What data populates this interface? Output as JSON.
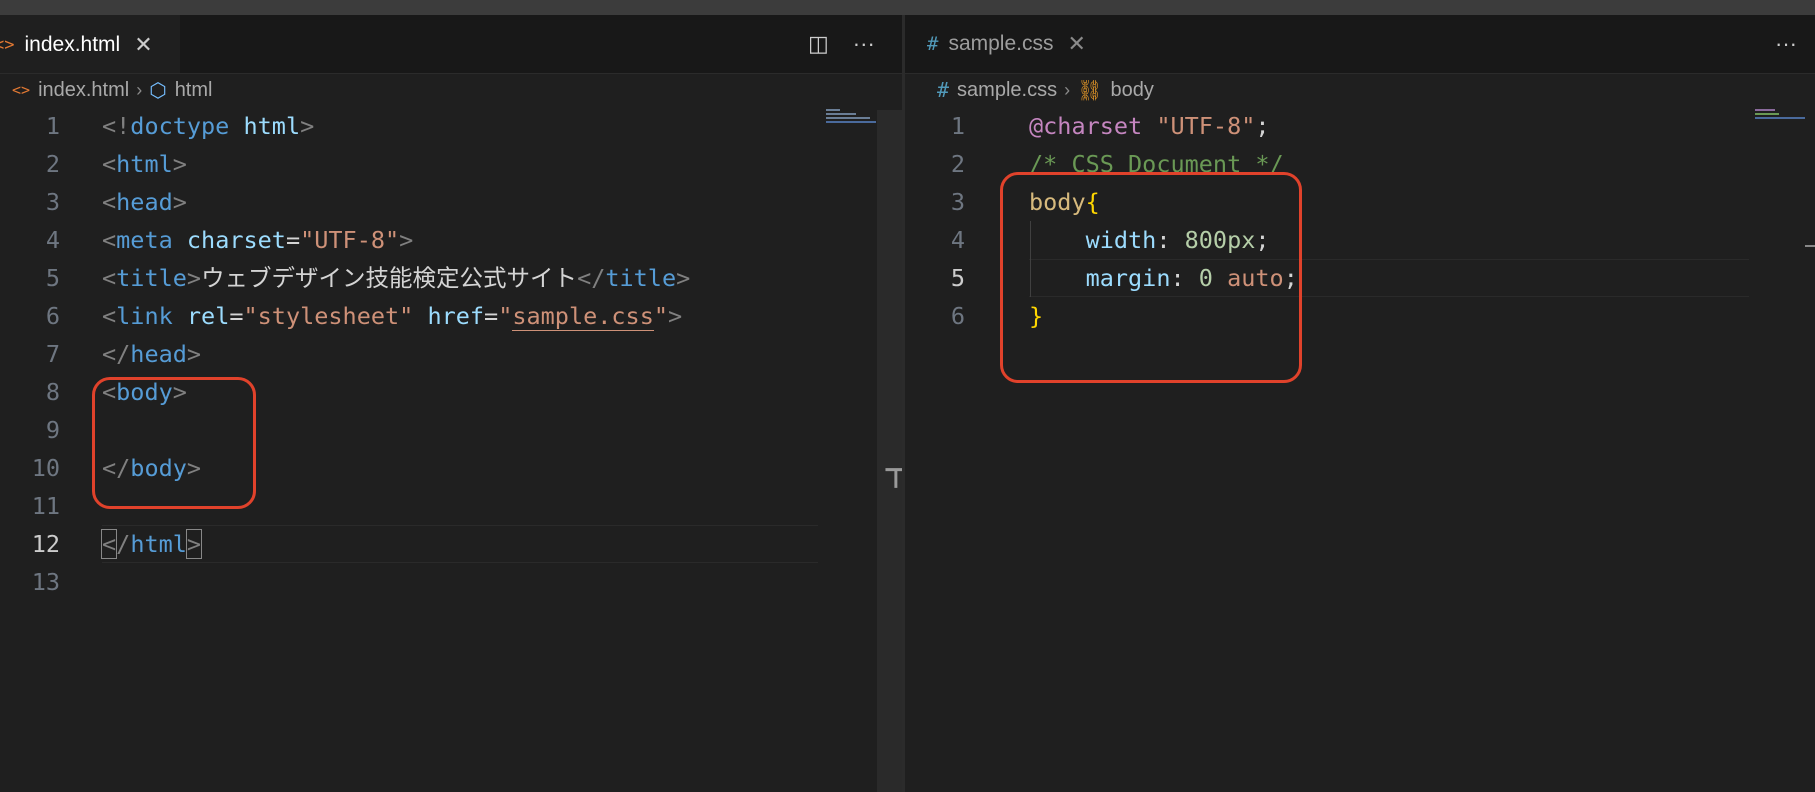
{
  "left_editor": {
    "tab": {
      "icon": "html-file-icon",
      "label": "index.html"
    },
    "breadcrumb": [
      {
        "icon": "html-file-icon",
        "label": "index.html"
      },
      {
        "icon": "symbol-element-icon",
        "label": "html"
      }
    ],
    "current_line": 12,
    "lines": [
      {
        "n": "1",
        "tokens": [
          [
            "bracket",
            "<!"
          ],
          [
            "tag",
            "doctype"
          ],
          [
            "text",
            " "
          ],
          [
            "attr",
            "html"
          ],
          [
            "bracket",
            ">"
          ]
        ]
      },
      {
        "n": "2",
        "tokens": [
          [
            "bracket",
            "<"
          ],
          [
            "tag",
            "html"
          ],
          [
            "bracket",
            ">"
          ]
        ]
      },
      {
        "n": "3",
        "tokens": [
          [
            "bracket",
            "<"
          ],
          [
            "tag",
            "head"
          ],
          [
            "bracket",
            ">"
          ]
        ]
      },
      {
        "n": "4",
        "tokens": [
          [
            "bracket",
            "<"
          ],
          [
            "tag",
            "meta"
          ],
          [
            "text",
            " "
          ],
          [
            "attr",
            "charset"
          ],
          [
            "eq",
            "="
          ],
          [
            "str",
            "\"UTF-8\""
          ],
          [
            "bracket",
            ">"
          ]
        ]
      },
      {
        "n": "5",
        "tokens": [
          [
            "bracket",
            "<"
          ],
          [
            "tag",
            "title"
          ],
          [
            "bracket",
            ">"
          ],
          [
            "text",
            "ウェブデザイン技能検定公式サイト"
          ],
          [
            "bracket",
            "</"
          ],
          [
            "tag",
            "title"
          ],
          [
            "bracket",
            ">"
          ]
        ]
      },
      {
        "n": "6",
        "tokens": [
          [
            "bracket",
            "<"
          ],
          [
            "tag",
            "link"
          ],
          [
            "text",
            " "
          ],
          [
            "attr",
            "rel"
          ],
          [
            "eq",
            "="
          ],
          [
            "str",
            "\"stylesheet\""
          ],
          [
            "text",
            " "
          ],
          [
            "attr",
            "href"
          ],
          [
            "eq",
            "="
          ],
          [
            "str",
            "\""
          ],
          [
            "link",
            "sample.css"
          ],
          [
            "str",
            "\""
          ],
          [
            "bracket",
            ">"
          ]
        ]
      },
      {
        "n": "7",
        "tokens": [
          [
            "bracket",
            "</"
          ],
          [
            "tag",
            "head"
          ],
          [
            "bracket",
            ">"
          ]
        ]
      },
      {
        "n": "8",
        "tokens": [
          [
            "bracket",
            "<"
          ],
          [
            "tag",
            "body"
          ],
          [
            "bracket",
            ">"
          ]
        ]
      },
      {
        "n": "9",
        "tokens": []
      },
      {
        "n": "10",
        "tokens": [
          [
            "bracket",
            "</"
          ],
          [
            "tag",
            "body"
          ],
          [
            "bracket",
            ">"
          ]
        ]
      },
      {
        "n": "11",
        "tokens": []
      },
      {
        "n": "12",
        "tokens": [
          [
            "boxbr",
            "<"
          ],
          [
            "bracket",
            "/"
          ],
          [
            "tag",
            "html"
          ],
          [
            "boxbr",
            ">"
          ]
        ]
      },
      {
        "n": "13",
        "tokens": []
      }
    ]
  },
  "right_editor": {
    "tab": {
      "icon": "css-file-icon",
      "label": "sample.css"
    },
    "breadcrumb": [
      {
        "icon": "css-file-icon",
        "label": "sample.css"
      },
      {
        "icon": "symbol-class-icon",
        "label": "body"
      }
    ],
    "current_line": 5,
    "lines": [
      {
        "n": "1",
        "tokens": [
          [
            "at",
            "@charset"
          ],
          [
            "text",
            " "
          ],
          [
            "str",
            "\"UTF-8\""
          ],
          [
            "punc",
            ";"
          ]
        ]
      },
      {
        "n": "2",
        "tokens": [
          [
            "comment",
            "/* CSS Document */"
          ]
        ]
      },
      {
        "n": "3",
        "tokens": [
          [
            "sel",
            "body"
          ],
          [
            "brace",
            "{"
          ]
        ]
      },
      {
        "n": "4",
        "tokens": [
          [
            "text",
            "    "
          ],
          [
            "prop",
            "width"
          ],
          [
            "punc",
            ": "
          ],
          [
            "num",
            "800px"
          ],
          [
            "punc",
            ";"
          ]
        ]
      },
      {
        "n": "5",
        "tokens": [
          [
            "text",
            "    "
          ],
          [
            "prop",
            "margin"
          ],
          [
            "punc",
            ": "
          ],
          [
            "num",
            "0"
          ],
          [
            "text",
            " "
          ],
          [
            "val",
            "auto"
          ],
          [
            "punc",
            ";"
          ]
        ]
      },
      {
        "n": "6",
        "tokens": [
          [
            "brace",
            "}"
          ]
        ]
      }
    ]
  },
  "actions": {
    "split_editor_icon": "split-editor-icon",
    "more_icon": "more-actions-icon",
    "more_glyph": "···",
    "split_glyph": "◫",
    "close_glyph": "✕",
    "chevron_glyph": "›"
  },
  "colors": {
    "highlight": "#e0422b",
    "background": "#1f1f1f"
  }
}
